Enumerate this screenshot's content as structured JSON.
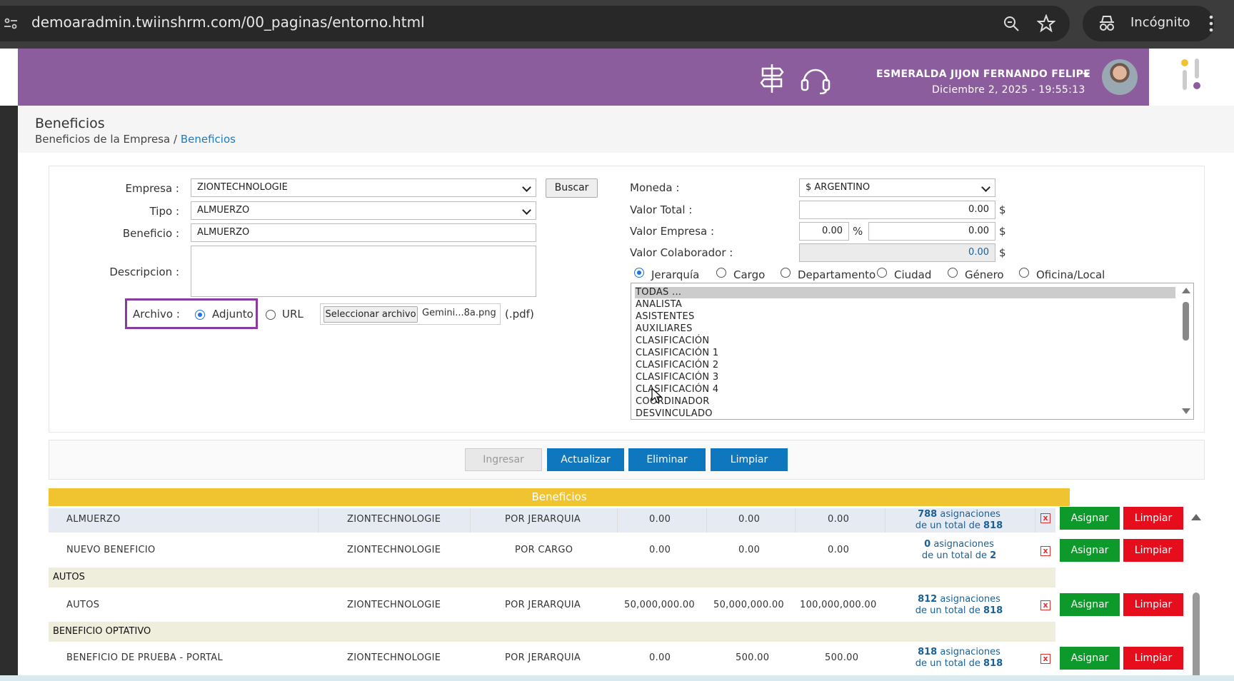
{
  "browser": {
    "url": "demoaradmin.twiinshrm.com/00_paginas/entorno.html",
    "mode_label": "Incógnito"
  },
  "header": {
    "user_name": "ESMERALDA JIJON FERNANDO FELIPE",
    "datetime": "Diciembre 2, 2025 -  19:55:13",
    "brand_color": "#8b5d9c"
  },
  "page": {
    "title": "Beneficios",
    "breadcrumb_root": "Beneficios de la Empresa",
    "breadcrumb_sep": "/",
    "breadcrumb_current": "Beneficios"
  },
  "form": {
    "empresa_label": "Empresa :",
    "empresa_value": "ZIONTECHNOLOGIE",
    "buscar_label": "Buscar",
    "tipo_label": "Tipo :",
    "tipo_value": "ALMUERZO",
    "beneficio_label": "Beneficio :",
    "beneficio_value": "ALMUERZO",
    "descripcion_label": "Descripcion :",
    "archivo_label": "Archivo :",
    "adjunto_label": "Adjunto",
    "url_label": "URL",
    "file_button": "Seleccionar archivo",
    "file_name": "Gemini...8a.png",
    "file_hint": "(.pdf)",
    "moneda_label": "Moneda :",
    "moneda_value": "$ ARGENTINO",
    "valor_total_label": "Valor Total :",
    "valor_total": "0.00",
    "valor_empresa_label": "Valor Empresa :",
    "valor_empresa_pct": "0.00",
    "valor_empresa": "0.00",
    "valor_colaborador_label": "Valor Colaborador :",
    "valor_colaborador": "0.00",
    "currency_sign": "$",
    "percent_sign": "%",
    "filters": [
      "Jerarquía",
      "Cargo",
      "Departamento",
      "Ciudad",
      "Género",
      "Oficina/Local"
    ],
    "list_items": [
      "TODAS ...",
      "ANALISTA",
      "ASISTENTES",
      "AUXILIARES",
      "CLASIFICACIÓN",
      "CLASIFICACIÓN 1",
      "CLASIFICACIÓN 2",
      "CLASIFICACIÓN 3",
      "CLASIFICACIÓN 4",
      "COORDINADOR",
      "DESVINCULADO"
    ]
  },
  "actions": {
    "ingresar": "Ingresar",
    "actualizar": "Actualizar",
    "eliminar": "Eliminar",
    "limpiar": "Limpiar"
  },
  "table": {
    "title": "Beneficios",
    "asignar_label": "Asignar",
    "limpiar_label": "Limpiar",
    "asig_word": "asignaciones",
    "total_prefix": "de un total de",
    "groups": [
      {
        "name": "",
        "rows": [
          {
            "name": "ALMUERZO",
            "empresa": "ZIONTECHNOLOGIE",
            "tipo": "POR JERARQUIA",
            "v1": "0.00",
            "v2": "0.00",
            "v3": "0.00",
            "asig": "788",
            "total": "818"
          },
          {
            "name": "NUEVO BENEFICIO",
            "empresa": "ZIONTECHNOLOGIE",
            "tipo": "POR CARGO",
            "v1": "0.00",
            "v2": "0.00",
            "v3": "0.00",
            "asig": "0",
            "total": "2"
          }
        ]
      },
      {
        "name": "AUTOS",
        "rows": [
          {
            "name": "AUTOS",
            "empresa": "ZIONTECHNOLOGIE",
            "tipo": "POR JERARQUIA",
            "v1": "50,000,000.00",
            "v2": "50,000,000.00",
            "v3": "100,000,000.00",
            "asig": "812",
            "total": "818"
          }
        ]
      },
      {
        "name": "BENEFICIO OPTATIVO",
        "rows": [
          {
            "name": "BENEFICIO DE PRUEBA - PORTAL",
            "empresa": "ZIONTECHNOLOGIE",
            "tipo": "POR JERARQUIA",
            "v1": "0.00",
            "v2": "500.00",
            "v3": "500.00",
            "asig": "818",
            "total": "818"
          }
        ]
      }
    ]
  }
}
